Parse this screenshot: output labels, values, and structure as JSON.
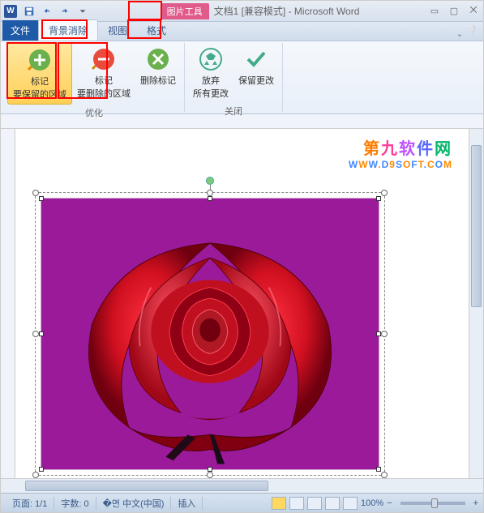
{
  "titlebar": {
    "app_initial": "W",
    "pic_tools": "图片工具",
    "doc_title": "文档1 [兼容模式] - Microsoft Word"
  },
  "tabs": {
    "file": "文件",
    "bg_remove": "背景消除",
    "view": "视图",
    "format": "格式"
  },
  "ribbon": {
    "mark_keep": {
      "line1": "标记",
      "line2": "要保留的区域"
    },
    "mark_remove": {
      "line1": "标记",
      "line2": "要删除的区域"
    },
    "delete_mark": "删除标记",
    "discard": {
      "line1": "放弃",
      "line2": "所有更改"
    },
    "keep_changes": "保留更改",
    "group_refine": "优化",
    "group_close": "关闭"
  },
  "watermark": {
    "cn": [
      "第",
      "九",
      "软",
      "件",
      "网"
    ],
    "url": "WWW.D9SOFT.COM"
  },
  "statusbar": {
    "page": "页面: 1/1",
    "words": "字数: 0",
    "lang": "中文(中国)",
    "insert": "插入",
    "zoom": "100%",
    "minus": "−",
    "plus": "+"
  }
}
